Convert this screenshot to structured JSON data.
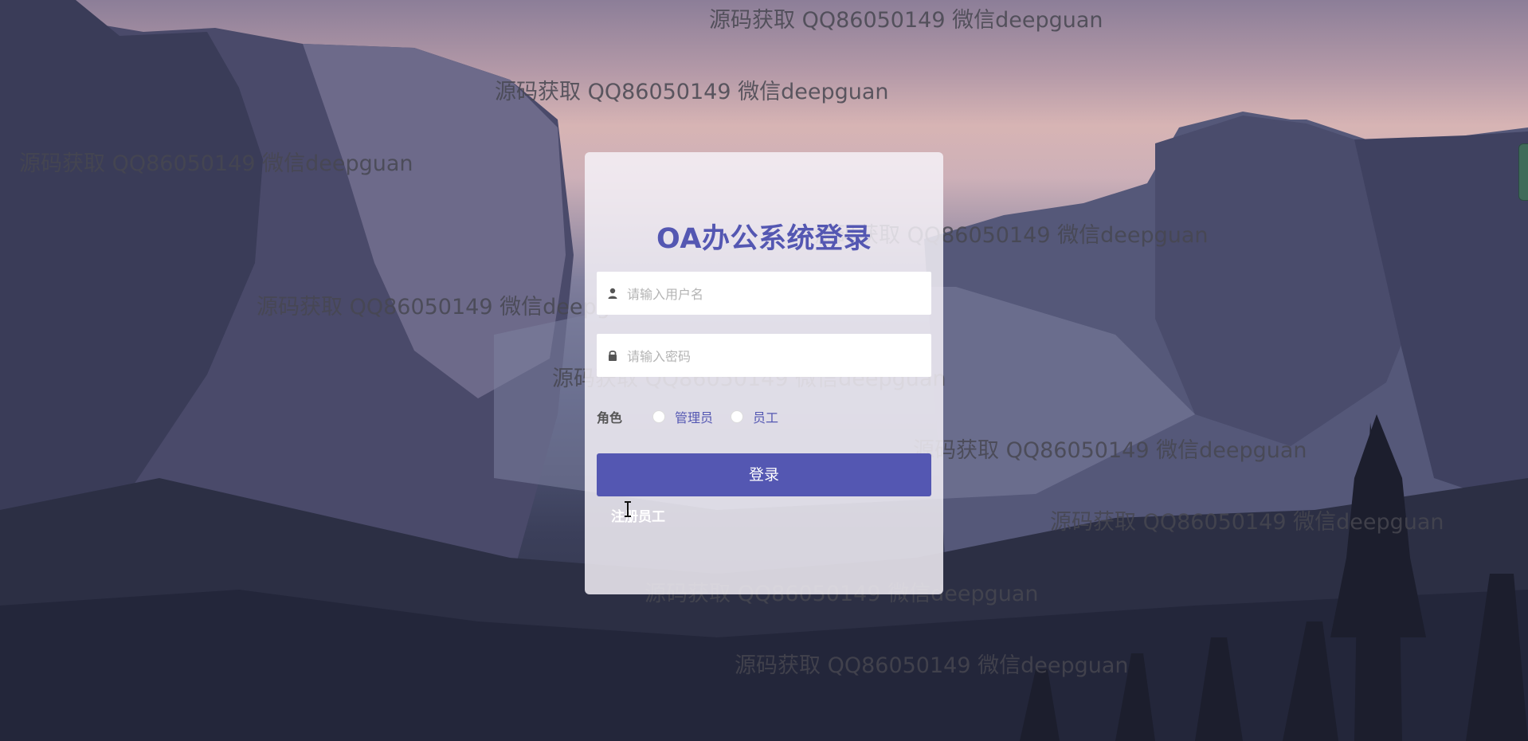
{
  "login": {
    "title": "OA办公系统登录",
    "username_placeholder": "请输入用户名",
    "password_placeholder": "请输入密码",
    "role_label": "角色",
    "roles": [
      "管理员",
      "员工"
    ],
    "login_button": "登录",
    "register_link": "注册员工"
  },
  "watermark_text": "源码获取 QQ86050149 微信deepguan",
  "icons": {
    "username": "user-icon",
    "password": "lock-icon"
  },
  "colors": {
    "accent": "#5457b2",
    "card_bg": "#f5f2f8"
  }
}
